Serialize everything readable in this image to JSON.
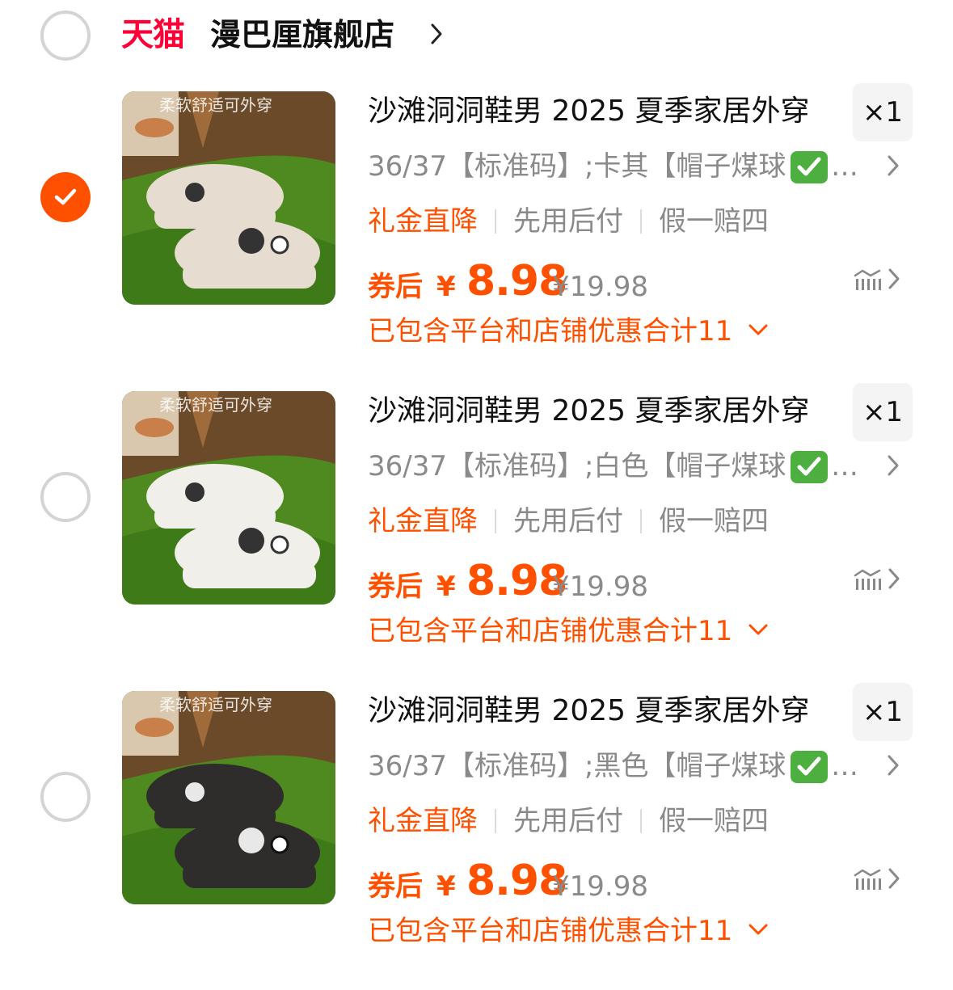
{
  "store": {
    "platform_logo": "天猫",
    "name": "漫巴厘旗舰店",
    "selected": false,
    "chevron_icon": "chevron-right-icon"
  },
  "items": [
    {
      "selected": true,
      "image_caption": "柔软舒适可外穿",
      "shoe_color": "#e6ddd0",
      "title": "沙滩洞洞鞋男 2025 夏季家居外穿",
      "quantity": "×1",
      "sku": "36/37【标准码】;卡其【帽子煤球",
      "sku_ellipsis": "…",
      "tags": [
        "礼金直降",
        "先用后付",
        "假一赔四"
      ],
      "price_label": "券后",
      "currency": "¥",
      "price": "8.98",
      "original_price": "¥19.98",
      "discount_text": "已包含平台和店铺优惠合计11"
    },
    {
      "selected": false,
      "image_caption": "柔软舒适可外穿",
      "shoe_color": "#f1efe9",
      "title": "沙滩洞洞鞋男 2025 夏季家居外穿",
      "quantity": "×1",
      "sku": "36/37【标准码】;白色【帽子煤球",
      "sku_ellipsis": "…",
      "tags": [
        "礼金直降",
        "先用后付",
        "假一赔四"
      ],
      "price_label": "券后",
      "currency": "¥",
      "price": "8.98",
      "original_price": "¥19.98",
      "discount_text": "已包含平台和店铺优惠合计11"
    },
    {
      "selected": false,
      "image_caption": "柔软舒适可外穿",
      "shoe_color": "#2f2d2b",
      "title": "沙滩洞洞鞋男 2025 夏季家居外穿",
      "quantity": "×1",
      "sku": "36/37【标准码】;黑色【帽子煤球",
      "sku_ellipsis": "…",
      "tags": [
        "礼金直降",
        "先用后付",
        "假一赔四"
      ],
      "price_label": "券后",
      "currency": "¥",
      "price": "8.98",
      "original_price": "¥19.98",
      "discount_text": "已包含平台和店铺优惠合计11"
    }
  ],
  "colors": {
    "accent": "#ff5000",
    "tmall_red": "#ff0036",
    "muted_text": "#8a8a8a",
    "radio_border": "#d4d4d4"
  }
}
